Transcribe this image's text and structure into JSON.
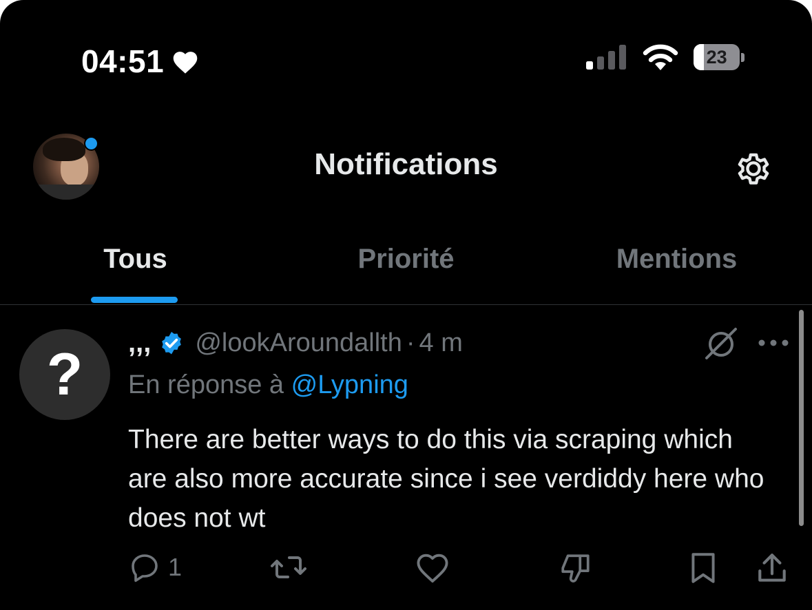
{
  "status_bar": {
    "time": "04:51",
    "battery_level": "23",
    "battery_fraction": 0.23,
    "icons": [
      "heart-icon",
      "cellular-signal-icon",
      "wifi-icon",
      "battery-icon"
    ]
  },
  "header": {
    "title": "Notifications",
    "avatar_icon": "profile-avatar",
    "settings_icon": "gear-icon"
  },
  "tabs": [
    {
      "label": "Tous",
      "active": true
    },
    {
      "label": "Priorité",
      "active": false
    },
    {
      "label": "Mentions",
      "active": false
    }
  ],
  "notification": {
    "avatar_glyph": "?",
    "display_name": ",,,",
    "handle": "@lookAroundallth",
    "separator": "·",
    "time": "4 m",
    "reply_prefix": "En réponse à",
    "reply_mention": "@Lypning",
    "text": "There are better ways to do this via scraping which are also more accurate since i see verdiddy here who does not wt",
    "actions": {
      "reply_count": "1",
      "icons": [
        "reply-icon",
        "retweet-icon",
        "like-icon",
        "dislike-icon",
        "bookmark-icon",
        "share-icon"
      ]
    }
  },
  "colors": {
    "background": "#000000",
    "accent": "#1d9bf0",
    "text_primary": "#e7e9ea",
    "text_secondary": "#71767b"
  }
}
